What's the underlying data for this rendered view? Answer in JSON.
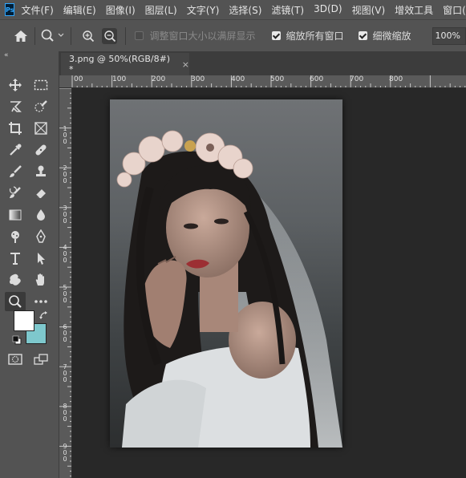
{
  "app": {
    "logo_text": "Ps"
  },
  "menu": [
    "文件(F)",
    "编辑(E)",
    "图像(I)",
    "图层(L)",
    "文字(Y)",
    "选择(S)",
    "滤镜(T)",
    "3D(D)",
    "视图(V)",
    "增效工具",
    "窗口(W)"
  ],
  "options": {
    "resize_windows_label": "调整窗口大小以满屏显示",
    "resize_windows_checked": false,
    "zoom_all_label": "缩放所有窗口",
    "zoom_all_checked": true,
    "scrubby_label": "细微缩放",
    "scrubby_checked": true,
    "zoom_value": "100%"
  },
  "document_tab": {
    "title": "3.png @ 50%(RGB/8#) *",
    "close": "×"
  },
  "ruler_h": [
    "00",
    "100",
    "200",
    "300",
    "400",
    "500",
    "600",
    "700",
    "800"
  ],
  "ruler_v": [
    "1\n0\n0",
    "2\n0\n0",
    "3\n0\n0",
    "4\n0\n0",
    "5\n0\n0",
    "6\n0\n0",
    "7\n0\n0",
    "8\n0\n0",
    "9\n0\n0"
  ],
  "colors": {
    "foreground": "#ffffff",
    "background": "#7ec8cd"
  },
  "tools": [
    "move",
    "marquee",
    "lasso",
    "quick-select",
    "crop",
    "frame",
    "eyedropper",
    "healing",
    "brush",
    "stamp",
    "history-brush",
    "eraser",
    "gradient",
    "blur",
    "dodge",
    "pen",
    "type",
    "path-select",
    "shape",
    "hand",
    "zoom",
    "more",
    "quick-mask",
    "screen-mode"
  ]
}
